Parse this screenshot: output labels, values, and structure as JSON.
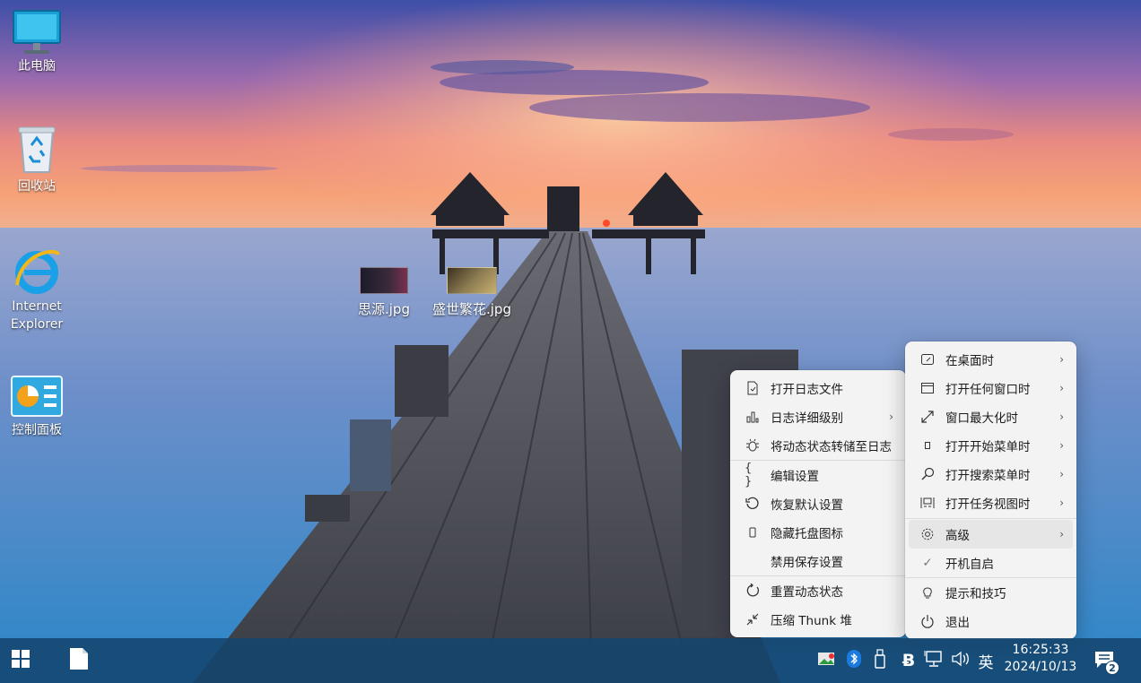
{
  "desktop": {
    "icons": [
      {
        "label": "此电脑"
      },
      {
        "label": "回收站"
      },
      {
        "label": "Internet\nExplorer"
      },
      {
        "label": "控制面板"
      }
    ],
    "files": [
      {
        "label": "思源.jpg"
      },
      {
        "label": "盛世繁花.jpg"
      }
    ]
  },
  "menu_left": {
    "items": [
      {
        "label": "打开日志文件",
        "icon": "log-file-icon"
      },
      {
        "label": "日志详细级别",
        "icon": "bar-chart-icon",
        "submenu": true
      },
      {
        "label": "将动态状态转储至日志",
        "icon": "bug-icon"
      },
      {
        "label": "编辑设置",
        "icon": "braces-icon"
      },
      {
        "label": "恢复默认设置",
        "icon": "restore-icon"
      },
      {
        "label": "隐藏托盘图标",
        "icon": "tray-rect-icon"
      },
      {
        "label": "禁用保存设置",
        "icon": ""
      },
      {
        "label": "重置动态状态",
        "icon": "reset-icon"
      },
      {
        "label": "压缩 Thunk 堆",
        "icon": "compress-icon"
      }
    ]
  },
  "menu_right": {
    "items": [
      {
        "label": "在桌面时",
        "icon": "desktop-icon",
        "submenu": true
      },
      {
        "label": "打开任何窗口时",
        "icon": "window-icon",
        "submenu": true
      },
      {
        "label": "窗口最大化时",
        "icon": "maximize-icon",
        "submenu": true
      },
      {
        "label": "打开开始菜单时",
        "icon": "start-menu-icon",
        "submenu": true
      },
      {
        "label": "打开搜索菜单时",
        "icon": "search-icon",
        "submenu": true
      },
      {
        "label": "打开任务视图时",
        "icon": "task-view-icon",
        "submenu": true
      },
      {
        "label": "高级",
        "icon": "gear-icon",
        "submenu": true
      },
      {
        "label": "开机自启",
        "icon": "check-icon"
      },
      {
        "label": "提示和技巧",
        "icon": "lightbulb-icon"
      },
      {
        "label": "退出",
        "icon": "power-icon"
      }
    ]
  },
  "taskbar": {
    "input_method": "英",
    "time": "16:25:33",
    "date": "2024/10/13",
    "notification_count": "2"
  },
  "colors": {
    "taskbar": "#14466e",
    "menu_bg": "#f3f3f3",
    "menu_highlight": "#e6e6e6"
  }
}
